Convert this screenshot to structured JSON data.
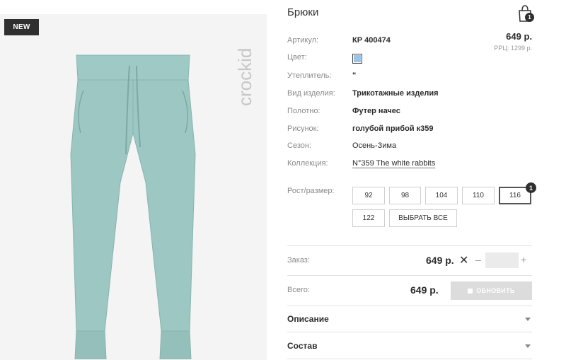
{
  "product": {
    "title": "Брюки",
    "badge": "NEW",
    "brand": "crockid",
    "price": "649 р.",
    "rrp": "РРЦ: 1299 р.",
    "swatch_color": "#9cc4e6",
    "fabric_color": "#9cc7c3"
  },
  "cart": {
    "count": "1"
  },
  "attributes": [
    {
      "label": "Артикул:",
      "value": "КР 400474"
    },
    {
      "label": "Цвет:",
      "value": ""
    },
    {
      "label": "Утеплитель:",
      "value": "\""
    },
    {
      "label": "Вид изделия:",
      "value": "Трикотажные изделия"
    },
    {
      "label": "Полотно:",
      "value": "Футер начес"
    },
    {
      "label": "Рисунок:",
      "value": "голубой прибой к359"
    },
    {
      "label": "Сезон:",
      "value": "Осень-Зима"
    },
    {
      "label": "Коллекция:",
      "value": "N°359 The white rabbits"
    }
  ],
  "sizes": {
    "label": "Рост/размер:",
    "options": [
      "92",
      "98",
      "104",
      "110",
      "116",
      "122"
    ],
    "selected": "116",
    "selected_count": "1",
    "select_all": "ВЫБРАТЬ ВСЕ"
  },
  "order": {
    "label": "Заказ:",
    "price": "649 р.",
    "remove": "✕",
    "minus": "–",
    "plus": "+",
    "quantity": ""
  },
  "total": {
    "label": "Всего:",
    "price": "649 р.",
    "update_button": "ОБНОВИТЬ"
  },
  "sections": [
    {
      "label": "Описание"
    },
    {
      "label": "Состав"
    }
  ]
}
